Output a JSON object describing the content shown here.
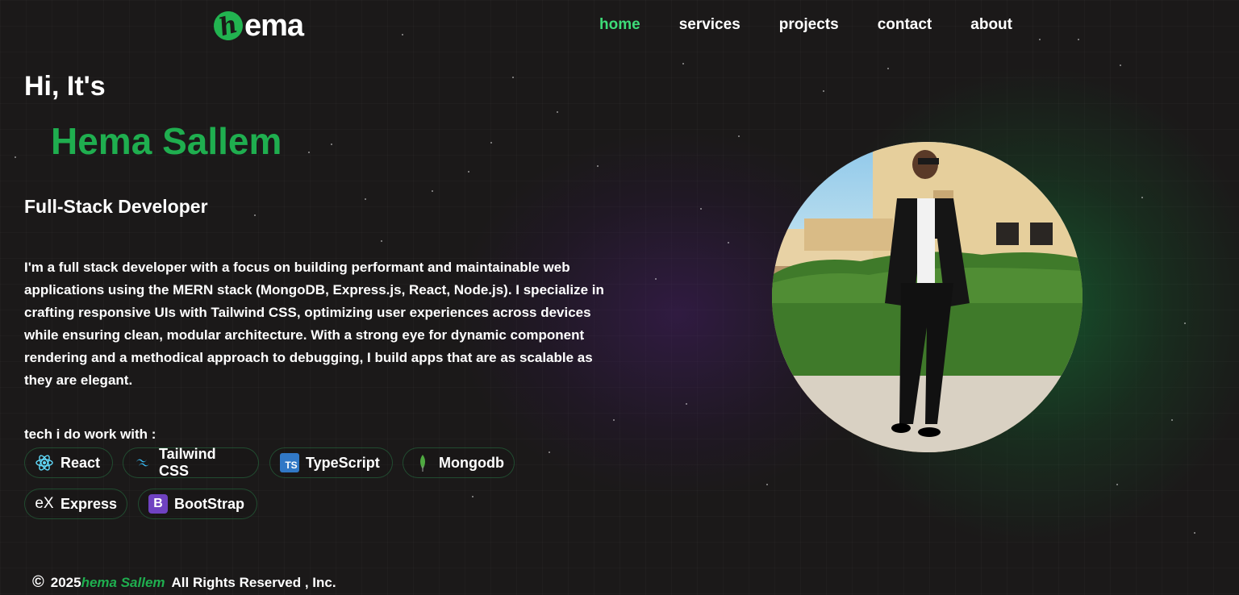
{
  "brand": {
    "logo_mark": "h",
    "logo_text": "ema",
    "accent_color": "#1fae4f",
    "nav_active_color": "#3ddc78"
  },
  "nav": {
    "items": [
      {
        "label": "home",
        "active": true
      },
      {
        "label": "services",
        "active": false
      },
      {
        "label": "projects",
        "active": false
      },
      {
        "label": "contact",
        "active": false
      },
      {
        "label": "about",
        "active": false
      }
    ]
  },
  "hero": {
    "greeting": "Hi, It's",
    "name": "Hema Sallem",
    "role": "Full-Stack Developer",
    "bio": "I'm a full stack developer with a focus on building performant and maintainable web applications using the MERN stack (MongoDB, Express.js, React, Node.js). I specialize in crafting responsive UIs with Tailwind CSS, optimizing user experiences across devices while ensuring clean, modular architecture. With a strong eye for dynamic component rendering and a methodical approach to debugging, I build apps that are as scalable as they are elegant.",
    "tech_title": "tech i do work with :",
    "tech": [
      {
        "label": "React",
        "icon": "react-icon"
      },
      {
        "label": "Tailwind CSS",
        "icon": "tailwind-icon"
      },
      {
        "label": "TypeScript",
        "icon": "typescript-icon",
        "icon_text": "TS"
      },
      {
        "label": "Mongodb",
        "icon": "mongodb-leaf-icon"
      },
      {
        "label": "Express",
        "icon": "express-icon",
        "icon_text": "eX"
      },
      {
        "label": "BootStrap",
        "icon": "bootstrap-icon",
        "icon_text": "B"
      }
    ]
  },
  "footer": {
    "copyright_symbol": "©",
    "year": "2025",
    "name": "hema Sallem",
    "rights": "All Rights Reserved , Inc."
  }
}
